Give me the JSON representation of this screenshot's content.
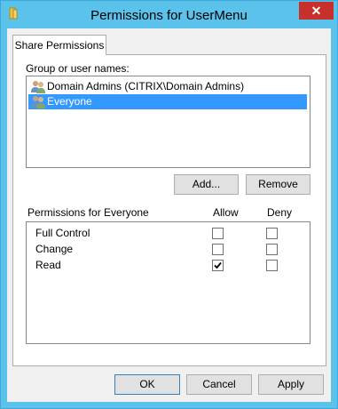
{
  "window": {
    "title": "Permissions for UserMenu",
    "close_symbol": "✕"
  },
  "tabs": [
    {
      "label": "Share Permissions",
      "selected": true
    }
  ],
  "groups": {
    "label": "Group or user names:",
    "items": [
      {
        "name": "Domain Admins (CITRIX\\Domain Admins)",
        "icon": "users-group-icon",
        "selected": false
      },
      {
        "name": "Everyone",
        "icon": "users-group-icon",
        "selected": true
      }
    ],
    "add_label": "Add...",
    "remove_label": "Remove"
  },
  "permissions": {
    "label": "Permissions for Everyone",
    "allow_header": "Allow",
    "deny_header": "Deny",
    "rows": [
      {
        "name": "Full Control",
        "allow": false,
        "deny": false
      },
      {
        "name": "Change",
        "allow": false,
        "deny": false
      },
      {
        "name": "Read",
        "allow": true,
        "deny": false
      }
    ]
  },
  "buttons": {
    "ok": "OK",
    "cancel": "Cancel",
    "apply": "Apply"
  },
  "colors": {
    "titlebar": "#5bc2ec",
    "close_button": "#c7302b",
    "selection": "#3399ff"
  }
}
